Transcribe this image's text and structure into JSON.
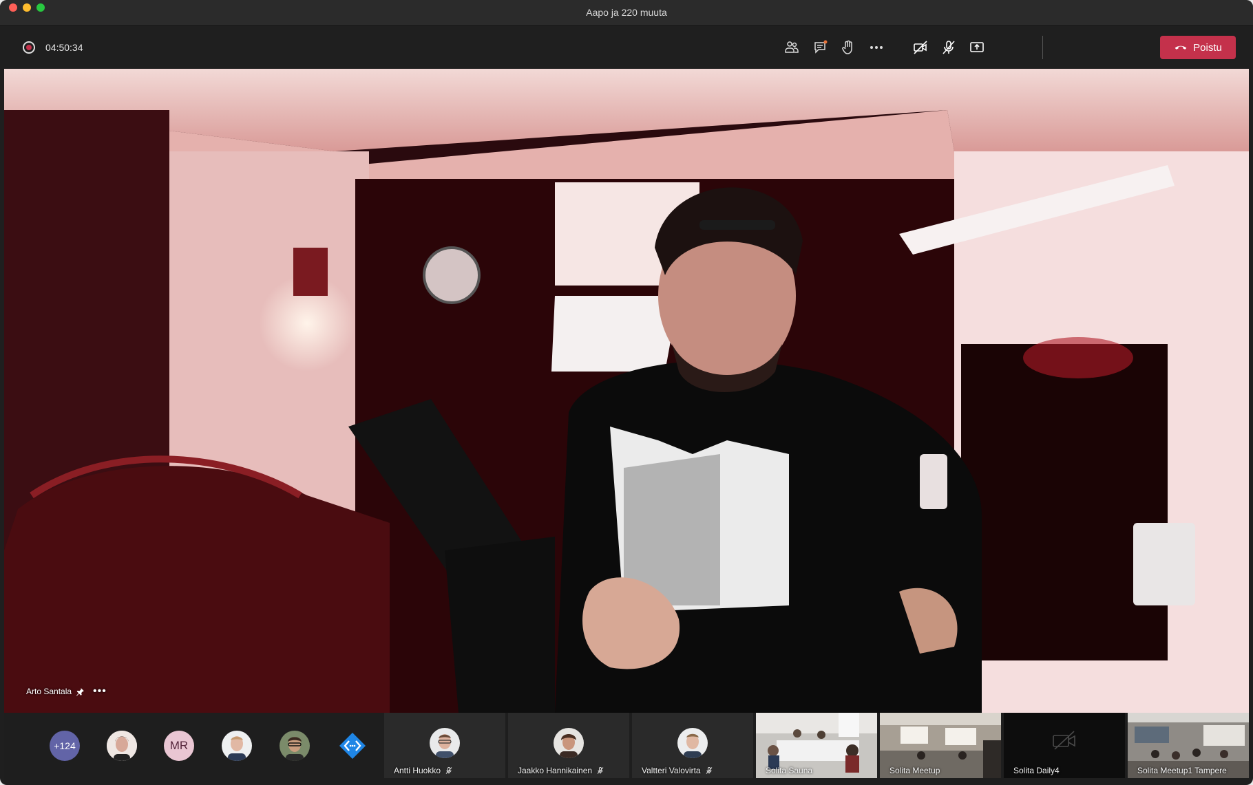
{
  "window": {
    "title": "Aapo ja 220 muuta"
  },
  "toolbar": {
    "timer": "04:50:34",
    "buttons": [
      {
        "icon": "participants-icon"
      },
      {
        "icon": "chat-icon"
      },
      {
        "icon": "raise-hand-icon"
      },
      {
        "icon": "more-actions-icon"
      },
      {
        "icon": "camera-off-icon"
      },
      {
        "icon": "mic-muted-icon"
      },
      {
        "icon": "share-screen-icon"
      }
    ],
    "leave_label": "Poistu",
    "accent_color": "#c4314b"
  },
  "stage": {
    "speaker_name": "Arto Santala",
    "more": "•••"
  },
  "strip": {
    "overflow_count": "+124",
    "avatars": [
      {
        "icon": "participant-photo"
      },
      {
        "initials": "MR"
      },
      {
        "icon": "participant-photo"
      },
      {
        "icon": "participant-photo"
      },
      {
        "icon": "code-badge-icon"
      }
    ],
    "tiles": [
      {
        "name": "Antti Huokko",
        "muted": true
      },
      {
        "name": "Jaakko Hannikainen",
        "muted": true
      },
      {
        "name": "Valtteri Valovirta",
        "muted": true
      },
      {
        "name": "Solita Sauna"
      },
      {
        "name": "Solita Meetup"
      },
      {
        "name": "Solita Daily4"
      },
      {
        "name": "Solita Meetup1 Tampere"
      }
    ]
  }
}
